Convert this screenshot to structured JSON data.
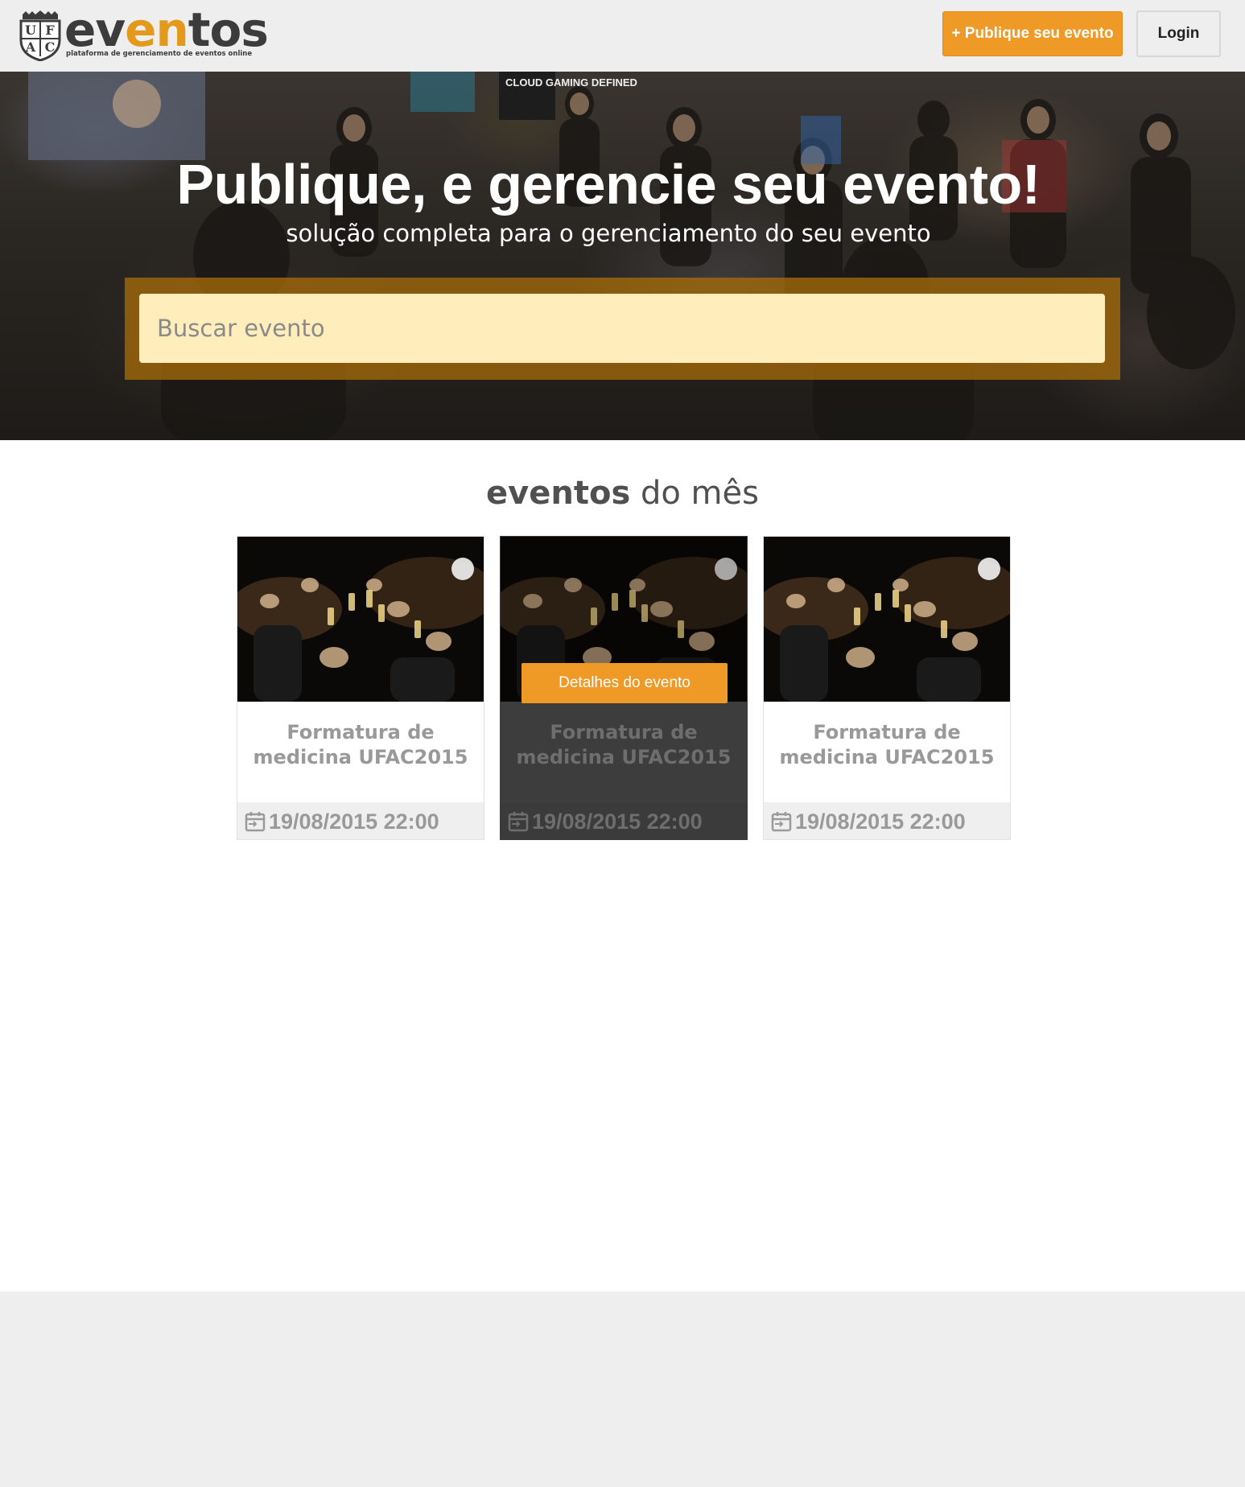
{
  "header": {
    "logo_word_pre": "ev",
    "logo_word_accent": "en",
    "logo_word_post": "tos",
    "logo_tagline": "plataforma de gerenciamento de eventos online",
    "crest_letters": [
      "U",
      "F",
      "A",
      "C"
    ],
    "publish_button": "+ Publique seu evento",
    "login_button": "Login"
  },
  "hero": {
    "title": "Publique, e gerencie seu evento!",
    "subtitle": "solução completa para o gerenciamento do seu evento",
    "search_placeholder": "Buscar evento",
    "booth_sign": "CLOUD GAMING DEFINED"
  },
  "events": {
    "title_bold": "eventos",
    "title_rest": " do mês",
    "details_button": "Detalhes do evento",
    "items": [
      {
        "name_line1": "Formatura de",
        "name_line2": "medicina UFAC2015",
        "date": "19/08/2015 22:00"
      },
      {
        "name_line1": "Formatura de",
        "name_line2": "medicina UFAC2015",
        "date": "19/08/2015 22:00"
      },
      {
        "name_line1": "Formatura de",
        "name_line2": "medicina UFAC2015",
        "date": "19/08/2015 22:00"
      }
    ]
  },
  "colors": {
    "accent": "#ef9a27",
    "header_bg": "#eeeeee",
    "search_bg": "#ffedbc",
    "card_hover_bg": "#3d3d3d"
  },
  "icons": [
    "crest-logo-icon",
    "calendar-icon"
  ]
}
